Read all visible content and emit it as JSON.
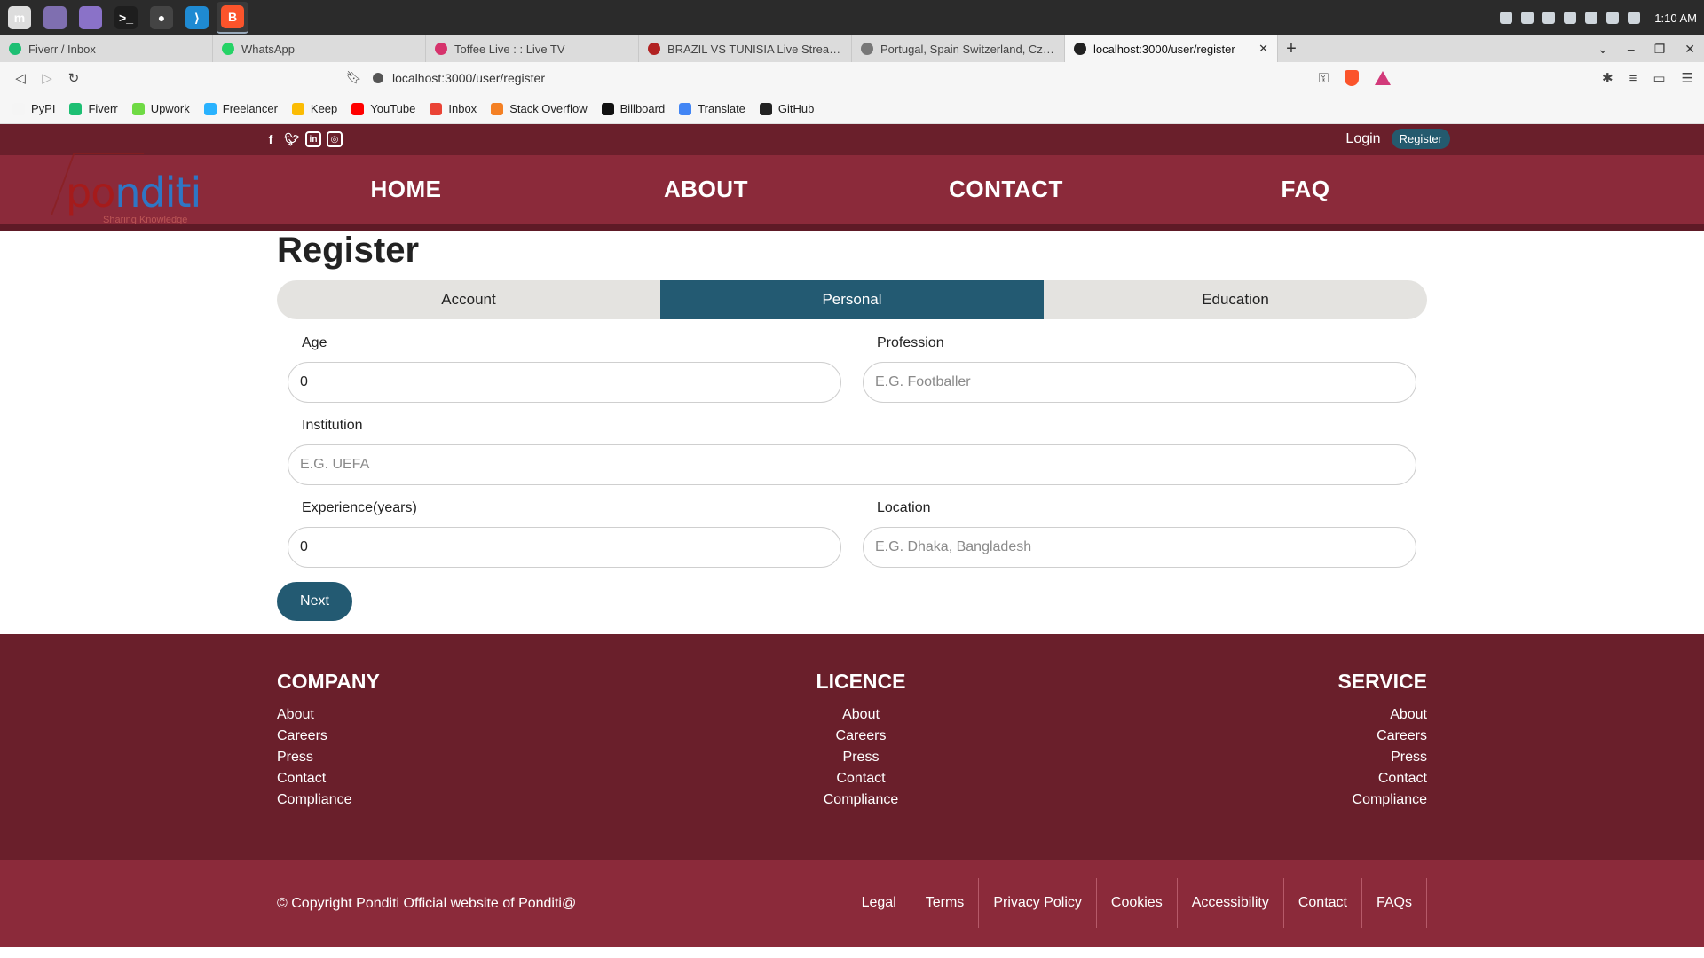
{
  "os": {
    "taskbar_apps": [
      {
        "name": "mint-menu-icon",
        "color": "#dddddd",
        "glyph": "m"
      },
      {
        "name": "workspace-icon",
        "color": "#7f6fb0",
        "glyph": ""
      },
      {
        "name": "files-icon",
        "color": "#8a72c8",
        "glyph": ""
      },
      {
        "name": "terminal-icon",
        "color": "#1e1e1e",
        "glyph": ">_"
      },
      {
        "name": "obs-icon",
        "color": "#444444",
        "glyph": "●"
      },
      {
        "name": "vscode-icon",
        "color": "#1f8ad2",
        "glyph": "⟩"
      },
      {
        "name": "brave-browser-icon",
        "color": "#fb542b",
        "glyph": "B"
      }
    ],
    "clock": "1:10 AM"
  },
  "browser": {
    "tabs": [
      {
        "title": "Fiverr / Inbox",
        "color": "#1dbf73",
        "active": false
      },
      {
        "title": "WhatsApp",
        "color": "#25d366",
        "active": false
      },
      {
        "title": "Toffee Live : : Live TV",
        "color": "#d6336c",
        "active": false
      },
      {
        "title": "BRAZIL VS TUNISIA Live Stream Or",
        "color": "#b22222",
        "active": false
      },
      {
        "title": "Portugal, Spain Switzerland, Czech",
        "color": "#777777",
        "active": false
      },
      {
        "title": "localhost:3000/user/register",
        "color": "#222222",
        "active": true
      }
    ],
    "url": "localhost:3000/user/register",
    "bookmarks": [
      {
        "label": "PyPI",
        "color": "#f5f5f5"
      },
      {
        "label": "Fiverr",
        "color": "#1dbf73"
      },
      {
        "label": "Upwork",
        "color": "#6fda44"
      },
      {
        "label": "Freelancer",
        "color": "#29b2fe"
      },
      {
        "label": "Keep",
        "color": "#fbbc04"
      },
      {
        "label": "YouTube",
        "color": "#ff0000"
      },
      {
        "label": "Inbox",
        "color": "#ea4335"
      },
      {
        "label": "Stack Overflow",
        "color": "#f48024"
      },
      {
        "label": "Billboard",
        "color": "#111111"
      },
      {
        "label": "Translate",
        "color": "#4285f4"
      },
      {
        "label": "GitHub",
        "color": "#222222"
      }
    ]
  },
  "site": {
    "header": {
      "login": "Login",
      "register": "Register",
      "logo_part1": "po",
      "logo_part2": "nditi",
      "logo_tagline": "Sharing Knowledge",
      "nav": [
        "HOME",
        "ABOUT",
        "CONTACT",
        "FAQ"
      ]
    },
    "form": {
      "title": "Register",
      "steps": [
        {
          "label": "Account",
          "active": false
        },
        {
          "label": "Personal",
          "active": true
        },
        {
          "label": "Education",
          "active": false
        }
      ],
      "age_label": "Age",
      "age_value": "0",
      "profession_label": "Profession",
      "profession_placeholder": "E.G. Footballer",
      "institution_label": "Institution",
      "institution_placeholder": "E.G. UEFA",
      "experience_label": "Experience(years)",
      "experience_value": "0",
      "location_label": "Location",
      "location_placeholder": "E.G. Dhaka, Bangladesh",
      "next": "Next"
    },
    "footer": {
      "columns": [
        {
          "title": "COMPANY",
          "links": [
            "About",
            "Careers",
            "Press",
            "Contact",
            "Compliance"
          ]
        },
        {
          "title": "LICENCE",
          "links": [
            "About",
            "Careers",
            "Press",
            "Contact",
            "Compliance"
          ]
        },
        {
          "title": "SERVICE",
          "links": [
            "About",
            "Careers",
            "Press",
            "Contact",
            "Compliance"
          ]
        }
      ],
      "copyright": "© Copyright Ponditi Official website of Ponditi@",
      "legal": [
        "Legal",
        "Terms",
        "Privacy Policy",
        "Cookies",
        "Accessibility",
        "Contact",
        "FAQs"
      ]
    },
    "colors": {
      "header": "#8b2a3a",
      "header_dark": "#6a1f2b",
      "accent": "#235a72"
    }
  }
}
